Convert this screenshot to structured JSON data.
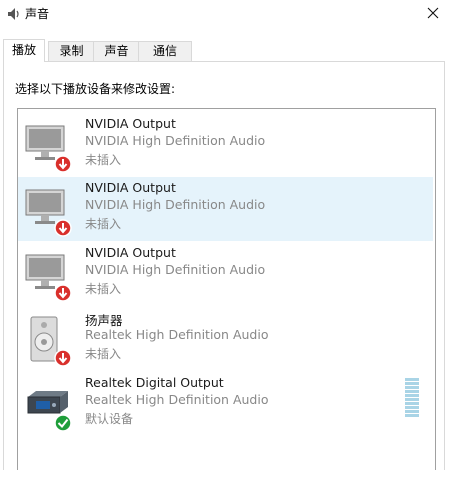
{
  "window": {
    "title": "声音",
    "icon": "speaker-icon"
  },
  "tabs": [
    {
      "label": "播放",
      "active": true
    },
    {
      "label": "录制",
      "active": false
    },
    {
      "label": "声音",
      "active": false
    },
    {
      "label": "通信",
      "active": false
    }
  ],
  "instruction": "选择以下播放设备来修改设置:",
  "devices": [
    {
      "name": "NVIDIA Output",
      "description": "NVIDIA High Definition Audio",
      "status": "未插入",
      "icon": "monitor-icon",
      "badge": "unplugged-badge-icon",
      "selected": false
    },
    {
      "name": "NVIDIA Output",
      "description": "NVIDIA High Definition Audio",
      "status": "未插入",
      "icon": "monitor-icon",
      "badge": "unplugged-badge-icon",
      "selected": true
    },
    {
      "name": "NVIDIA Output",
      "description": "NVIDIA High Definition Audio",
      "status": "未插入",
      "icon": "monitor-icon",
      "badge": "unplugged-badge-icon",
      "selected": false
    },
    {
      "name": "扬声器",
      "description": "Realtek High Definition Audio",
      "status": "未插入",
      "icon": "speaker-icon",
      "badge": "unplugged-badge-icon",
      "selected": false
    },
    {
      "name": "Realtek Digital Output",
      "description": "Realtek High Definition Audio",
      "status": "默认设备",
      "icon": "digital-output-icon",
      "badge": "default-check-icon",
      "selected": false
    }
  ],
  "colors": {
    "selection": "#e5f3fb",
    "unplugged_badge": "#d9302c",
    "default_badge": "#1e9e3a",
    "level_meter": "#a9d4e6"
  }
}
